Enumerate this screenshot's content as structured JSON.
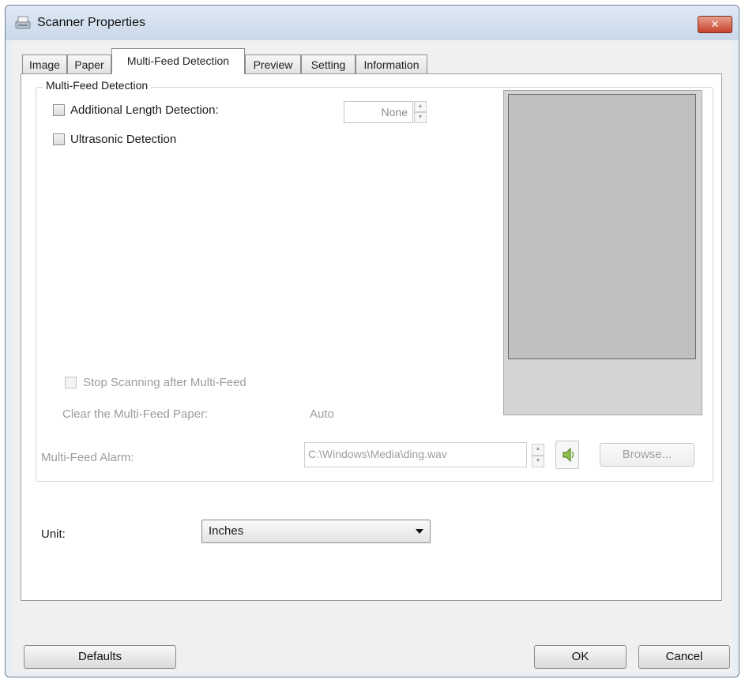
{
  "window": {
    "title": "Scanner Properties",
    "close_symbol": "✕"
  },
  "tabs": [
    {
      "label": "Image"
    },
    {
      "label": "Paper"
    },
    {
      "label": "Multi-Feed Detection"
    },
    {
      "label": "Preview"
    },
    {
      "label": "Setting"
    },
    {
      "label": "Information"
    }
  ],
  "active_tab": "Multi-Feed Detection",
  "multifeed": {
    "group_label": "Multi-Feed Detection",
    "additional_length_label": "Additional Length Detection:",
    "additional_length_checked": false,
    "additional_length_value": "None",
    "ultrasonic_label": "Ultrasonic Detection",
    "ultrasonic_checked": false,
    "stop_scanning_label": "Stop Scanning after Multi-Feed",
    "stop_scanning_checked": false,
    "clear_paper_label": "Clear the Multi-Feed Paper:",
    "clear_paper_value": "Auto",
    "alarm_label": "Multi-Feed Alarm:",
    "alarm_path": "C:\\Windows\\Media\\ding.wav",
    "browse_label": "Browse..."
  },
  "unit": {
    "label": "Unit:",
    "value": "Inches"
  },
  "buttons": {
    "defaults": "Defaults",
    "ok": "OK",
    "cancel": "Cancel"
  },
  "colors": {
    "close_button": "#c7432b",
    "page_bg": "#ffffff",
    "dialog_bg": "#f0f0f0"
  }
}
